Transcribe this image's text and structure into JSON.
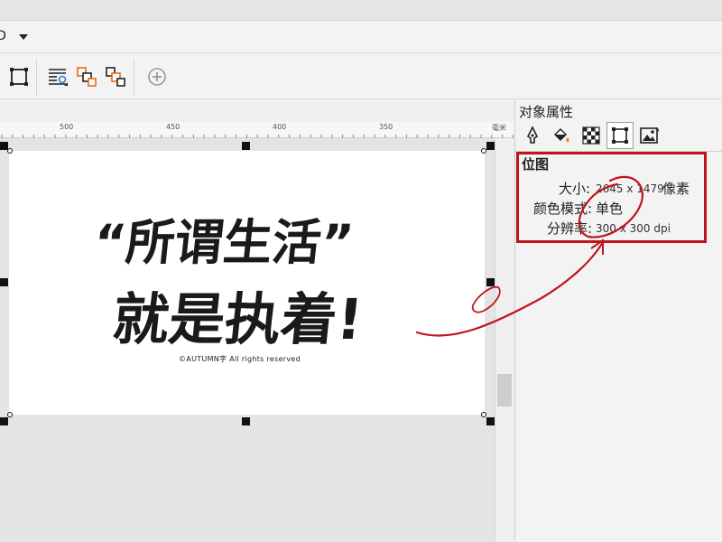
{
  "menubar": {
    "fragment": "ID",
    "dropdown_icon": "chevron-down-icon"
  },
  "toolbar": {
    "buttons": [
      {
        "name": "frame-select-icon"
      },
      {
        "name": "text-wrap-icon"
      },
      {
        "name": "arrange-front-icon"
      },
      {
        "name": "arrange-back-icon"
      },
      {
        "name": "add-icon"
      }
    ]
  },
  "ruler": {
    "ticks": [
      "500",
      "450",
      "400",
      "350"
    ],
    "unit": "毫米"
  },
  "artwork": {
    "line1": "“所谓生活”",
    "line2": "就是执着!",
    "copyright": "©AUTUMN字 All rights reserved"
  },
  "docker": {
    "title": "对象属性",
    "tabs": [
      "outline-pen-icon",
      "fill-icon",
      "transparency-icon",
      "bitmap-frame-icon",
      "image-icon"
    ],
    "section": "位图",
    "rows": [
      {
        "label": "大小:",
        "value": "2645 x 1479",
        "unit": "像素"
      },
      {
        "label": "颜色模式:",
        "value": "单色"
      },
      {
        "label": "分辨率:",
        "value": "300 x 300 dpi"
      }
    ]
  },
  "colors": {
    "annotation_red": "#c0141c",
    "accent_orange": "#e86a10",
    "accent_blue": "#2f7fd0"
  }
}
